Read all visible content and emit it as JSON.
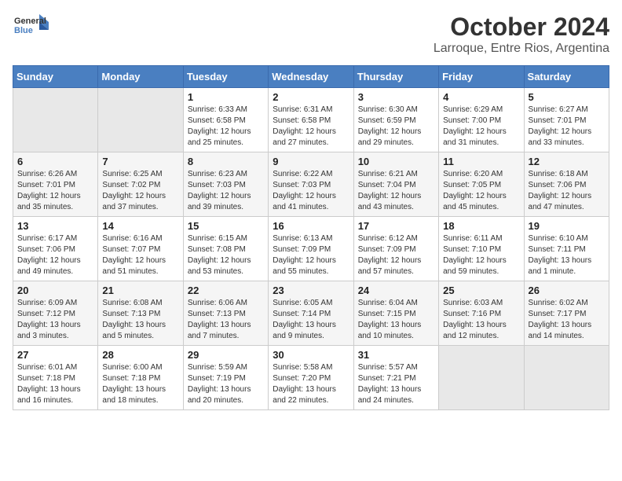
{
  "logo": {
    "general": "General",
    "blue": "Blue"
  },
  "title": "October 2024",
  "subtitle": "Larroque, Entre Rios, Argentina",
  "days_header": [
    "Sunday",
    "Monday",
    "Tuesday",
    "Wednesday",
    "Thursday",
    "Friday",
    "Saturday"
  ],
  "weeks": [
    [
      {
        "day": "",
        "empty": true
      },
      {
        "day": "",
        "empty": true
      },
      {
        "day": "1",
        "sunrise": "6:33 AM",
        "sunset": "6:58 PM",
        "daylight": "12 hours and 25 minutes."
      },
      {
        "day": "2",
        "sunrise": "6:31 AM",
        "sunset": "6:58 PM",
        "daylight": "12 hours and 27 minutes."
      },
      {
        "day": "3",
        "sunrise": "6:30 AM",
        "sunset": "6:59 PM",
        "daylight": "12 hours and 29 minutes."
      },
      {
        "day": "4",
        "sunrise": "6:29 AM",
        "sunset": "7:00 PM",
        "daylight": "12 hours and 31 minutes."
      },
      {
        "day": "5",
        "sunrise": "6:27 AM",
        "sunset": "7:01 PM",
        "daylight": "12 hours and 33 minutes."
      }
    ],
    [
      {
        "day": "6",
        "sunrise": "6:26 AM",
        "sunset": "7:01 PM",
        "daylight": "12 hours and 35 minutes."
      },
      {
        "day": "7",
        "sunrise": "6:25 AM",
        "sunset": "7:02 PM",
        "daylight": "12 hours and 37 minutes."
      },
      {
        "day": "8",
        "sunrise": "6:23 AM",
        "sunset": "7:03 PM",
        "daylight": "12 hours and 39 minutes."
      },
      {
        "day": "9",
        "sunrise": "6:22 AM",
        "sunset": "7:03 PM",
        "daylight": "12 hours and 41 minutes."
      },
      {
        "day": "10",
        "sunrise": "6:21 AM",
        "sunset": "7:04 PM",
        "daylight": "12 hours and 43 minutes."
      },
      {
        "day": "11",
        "sunrise": "6:20 AM",
        "sunset": "7:05 PM",
        "daylight": "12 hours and 45 minutes."
      },
      {
        "day": "12",
        "sunrise": "6:18 AM",
        "sunset": "7:06 PM",
        "daylight": "12 hours and 47 minutes."
      }
    ],
    [
      {
        "day": "13",
        "sunrise": "6:17 AM",
        "sunset": "7:06 PM",
        "daylight": "12 hours and 49 minutes."
      },
      {
        "day": "14",
        "sunrise": "6:16 AM",
        "sunset": "7:07 PM",
        "daylight": "12 hours and 51 minutes."
      },
      {
        "day": "15",
        "sunrise": "6:15 AM",
        "sunset": "7:08 PM",
        "daylight": "12 hours and 53 minutes."
      },
      {
        "day": "16",
        "sunrise": "6:13 AM",
        "sunset": "7:09 PM",
        "daylight": "12 hours and 55 minutes."
      },
      {
        "day": "17",
        "sunrise": "6:12 AM",
        "sunset": "7:09 PM",
        "daylight": "12 hours and 57 minutes."
      },
      {
        "day": "18",
        "sunrise": "6:11 AM",
        "sunset": "7:10 PM",
        "daylight": "12 hours and 59 minutes."
      },
      {
        "day": "19",
        "sunrise": "6:10 AM",
        "sunset": "7:11 PM",
        "daylight": "13 hours and 1 minute."
      }
    ],
    [
      {
        "day": "20",
        "sunrise": "6:09 AM",
        "sunset": "7:12 PM",
        "daylight": "13 hours and 3 minutes."
      },
      {
        "day": "21",
        "sunrise": "6:08 AM",
        "sunset": "7:13 PM",
        "daylight": "13 hours and 5 minutes."
      },
      {
        "day": "22",
        "sunrise": "6:06 AM",
        "sunset": "7:13 PM",
        "daylight": "13 hours and 7 minutes."
      },
      {
        "day": "23",
        "sunrise": "6:05 AM",
        "sunset": "7:14 PM",
        "daylight": "13 hours and 9 minutes."
      },
      {
        "day": "24",
        "sunrise": "6:04 AM",
        "sunset": "7:15 PM",
        "daylight": "13 hours and 10 minutes."
      },
      {
        "day": "25",
        "sunrise": "6:03 AM",
        "sunset": "7:16 PM",
        "daylight": "13 hours and 12 minutes."
      },
      {
        "day": "26",
        "sunrise": "6:02 AM",
        "sunset": "7:17 PM",
        "daylight": "13 hours and 14 minutes."
      }
    ],
    [
      {
        "day": "27",
        "sunrise": "6:01 AM",
        "sunset": "7:18 PM",
        "daylight": "13 hours and 16 minutes."
      },
      {
        "day": "28",
        "sunrise": "6:00 AM",
        "sunset": "7:18 PM",
        "daylight": "13 hours and 18 minutes."
      },
      {
        "day": "29",
        "sunrise": "5:59 AM",
        "sunset": "7:19 PM",
        "daylight": "13 hours and 20 minutes."
      },
      {
        "day": "30",
        "sunrise": "5:58 AM",
        "sunset": "7:20 PM",
        "daylight": "13 hours and 22 minutes."
      },
      {
        "day": "31",
        "sunrise": "5:57 AM",
        "sunset": "7:21 PM",
        "daylight": "13 hours and 24 minutes."
      },
      {
        "day": "",
        "empty": true
      },
      {
        "day": "",
        "empty": true
      }
    ]
  ]
}
